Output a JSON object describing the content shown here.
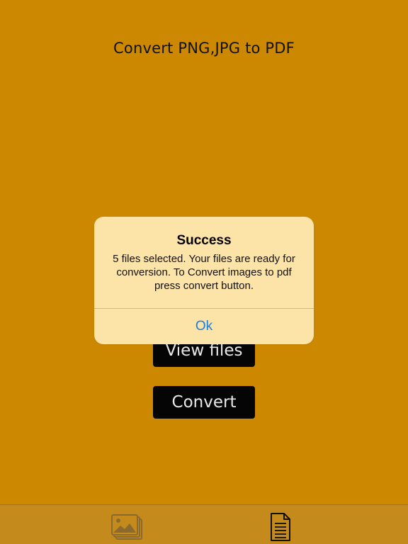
{
  "header": {
    "title": "Convert PNG,JPG to PDF"
  },
  "buttons": {
    "view_files_label": "View files",
    "convert_label": "Convert"
  },
  "tabbar": {
    "items": [
      {
        "icon": "images-icon",
        "active": false
      },
      {
        "icon": "document-icon",
        "active": true
      }
    ]
  },
  "alert": {
    "title": "Success",
    "message": "5 files selected. Your files are ready for conversion. To Convert images to pdf press convert button.",
    "ok_label": "Ok"
  },
  "colors": {
    "background": "#CC8800",
    "button_bg": "#050505",
    "alert_bg": "#FCE3A8",
    "link_blue": "#1A7FE0"
  }
}
